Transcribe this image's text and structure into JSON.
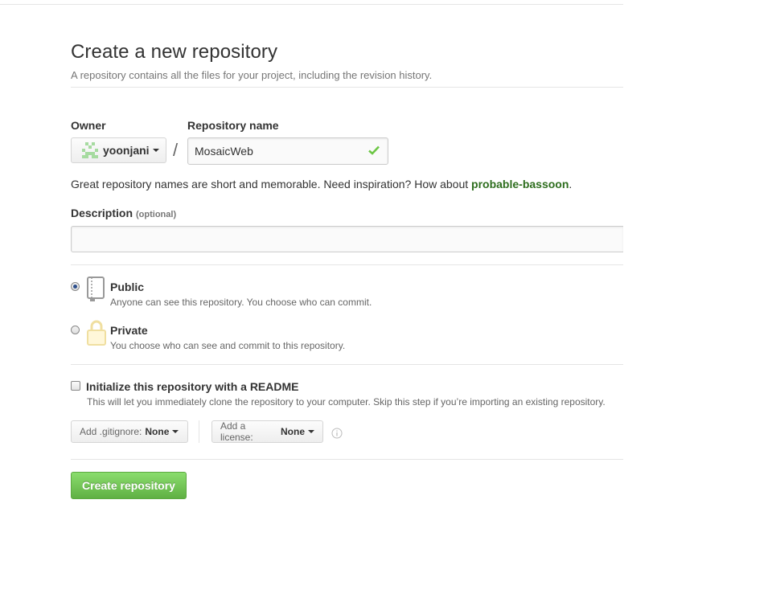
{
  "page": {
    "title": "Create a new repository",
    "subtitle": "A repository contains all the files for your project, including the revision history."
  },
  "owner": {
    "label": "Owner",
    "value": "yoonjani",
    "avatar_icon": "identicon-avatar"
  },
  "repository": {
    "label": "Repository name",
    "value": "MosaicWeb",
    "valid_icon": "check-icon"
  },
  "hint": {
    "text": "Great repository names are short and memorable. Need inspiration? How about",
    "suggestion": "probable-bassoon",
    "suffix": "."
  },
  "description": {
    "label": "Description",
    "optional": "(optional)",
    "value": ""
  },
  "visibility": {
    "selected": "public",
    "public": {
      "title": "Public",
      "desc": "Anyone can see this repository. You choose who can commit.",
      "icon": "repo-book-icon"
    },
    "private": {
      "title": "Private",
      "desc": "You choose who can see and commit to this repository.",
      "icon": "lock-icon"
    }
  },
  "readme": {
    "checked": false,
    "title": "Initialize this repository with a README",
    "desc": "This will let you immediately clone the repository to your computer. Skip this step if you’re importing an existing repository."
  },
  "gitignore": {
    "prefix": "Add .gitignore:",
    "value": "None"
  },
  "license": {
    "prefix": "Add a license:",
    "value": "None",
    "info_icon": "info-icon"
  },
  "submit": {
    "label": "Create repository"
  },
  "colors": {
    "primary_button": "#60b044",
    "suggestion": "#2e6e1e",
    "check": "#6cc644"
  }
}
